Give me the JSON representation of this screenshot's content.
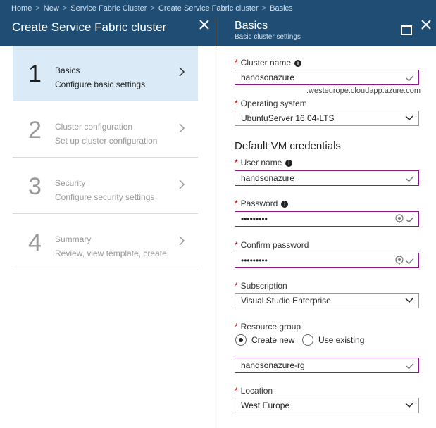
{
  "breadcrumb": [
    "Home",
    "New",
    "Service Fabric Cluster",
    "Create Service Fabric cluster",
    "Basics"
  ],
  "left": {
    "title": "Create Service Fabric cluster",
    "steps": [
      {
        "num": "1",
        "title": "Basics",
        "subtitle": "Configure basic settings",
        "active": true
      },
      {
        "num": "2",
        "title": "Cluster configuration",
        "subtitle": "Set up cluster configuration",
        "active": false
      },
      {
        "num": "3",
        "title": "Security",
        "subtitle": "Configure security settings",
        "active": false
      },
      {
        "num": "4",
        "title": "Summary",
        "subtitle": "Review, view template, create",
        "active": false
      }
    ]
  },
  "right": {
    "title": "Basics",
    "subtitle": "Basic cluster settings",
    "required_mark": "*",
    "cluster_name": {
      "label": "Cluster name",
      "value": "handsonazure",
      "suffix": ".westeurope.cloudapp.azure.com"
    },
    "os": {
      "label": "Operating system",
      "value": "UbuntuServer 16.04-LTS"
    },
    "vm_section": "Default VM credentials",
    "username": {
      "label": "User name",
      "value": "handsonazure"
    },
    "password": {
      "label": "Password",
      "value": "•••••••••"
    },
    "confirm_password": {
      "label": "Confirm password",
      "value": "•••••••••"
    },
    "subscription": {
      "label": "Subscription",
      "value": "Visual Studio Enterprise"
    },
    "resource_group": {
      "label": "Resource group",
      "create_new": "Create new",
      "use_existing": "Use existing",
      "selected": "create_new",
      "value": "handsonazure-rg"
    },
    "location": {
      "label": "Location",
      "value": "West Europe"
    }
  },
  "colors": {
    "header": "#1f4d73",
    "active_step": "#dbeaf7",
    "valid_border": "#8a1a8a",
    "required": "#cc0000"
  },
  "icons": {
    "close": "close-icon",
    "maximize": "maximize-icon",
    "info": "info-icon",
    "check": "check-icon",
    "dropdown": "chevron-down-icon",
    "reveal": "eye-icon",
    "step_arrow": "chevron-right-icon"
  }
}
